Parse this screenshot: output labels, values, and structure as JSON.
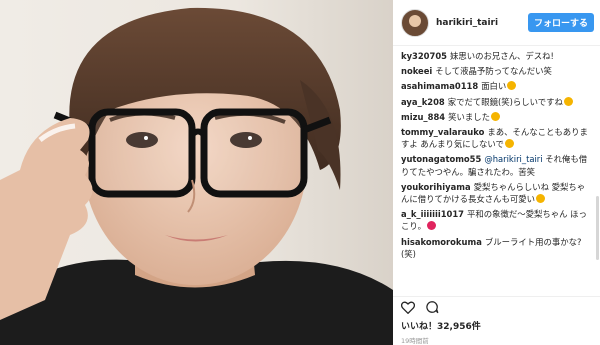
{
  "header": {
    "username": "harikiri_tairi",
    "follow_label": "フォローする"
  },
  "comments": [
    {
      "user": "ky320705",
      "text": "妹思いのお兄さん、デスね!"
    },
    {
      "user": "nokeei",
      "text": "そして液晶予防ってなんだい笑"
    },
    {
      "user": "asahimama0118",
      "text": "面白い",
      "emoji": "#f5b400"
    },
    {
      "user": "aya_k208",
      "text": "家でだて眼鏡(笑)らしいですね",
      "emoji": "#f5b400"
    },
    {
      "user": "mizu_884",
      "text": "笑いました",
      "emoji": "#f5b400"
    },
    {
      "user": "tommy_valarauko",
      "text": "まあ、そんなこともありますよ あんまり気にしないで",
      "emoji": "#f5b400"
    },
    {
      "user": "yutonagatomo55",
      "mention": "@harikiri_tairi",
      "text": "それ俺も借りてたやつやん。騙されたわ。苦笑"
    },
    {
      "user": "youkorihiyama",
      "text": "愛梨ちゃんらしいね 愛梨ちゃんに借りてかける長女さんも可愛い",
      "emoji": "#f5b400"
    },
    {
      "user": "a_k_iiiiiii1017",
      "text": "平和の象徴だ〜愛梨ちゃん ほっこり。",
      "emoji": "#e0245e"
    },
    {
      "user": "hisakomorokuma",
      "text": "ブルーライト用の事かな?(笑)"
    }
  ],
  "likes_text": "いいね！32,956件",
  "time_text": "19時間前",
  "icons": {
    "heart": "heart-icon",
    "comment": "comment-icon"
  }
}
